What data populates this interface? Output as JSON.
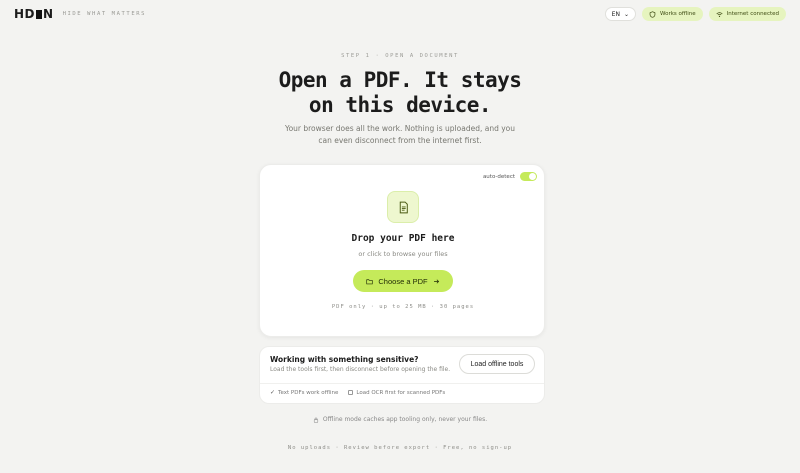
{
  "header": {
    "logo": "HD■N",
    "logo_left": "HD",
    "logo_right": "N",
    "tagline": "HIDE WHAT MATTERS",
    "language": "EN",
    "works_offline": "Works offline",
    "internet_status": "Internet connected"
  },
  "hero": {
    "step": "STEP 1 · OPEN A DOCUMENT",
    "title_line1": "Open a PDF. It stays",
    "title_line2": "on this device.",
    "subtitle": "Your browser does all the work. Nothing is uploaded, and you can even disconnect from the internet first."
  },
  "upload": {
    "auto_detect_label": "auto-detect",
    "auto_detect_on": true,
    "drop_title": "Drop your PDF here",
    "drop_sub": "or click to browse your files",
    "choose_label": "Choose a PDF",
    "limits": "PDF only · up to 25 MB · 30 pages"
  },
  "sensitive": {
    "title": "Working with something sensitive?",
    "sub": "Load the tools first, then disconnect before opening the file.",
    "load_button": "Load offline tools",
    "opt1": "Text PDFs work offline",
    "opt2": "Load OCR first for scanned PDFs"
  },
  "offline_note": "Offline mode caches app tooling only, never your files.",
  "footer": "No uploads · Review before export · Free, no sign-up",
  "colors": {
    "accent": "#c5ea5a",
    "pill_bg": "#e6f4bf",
    "bg": "#f3f3f1"
  }
}
